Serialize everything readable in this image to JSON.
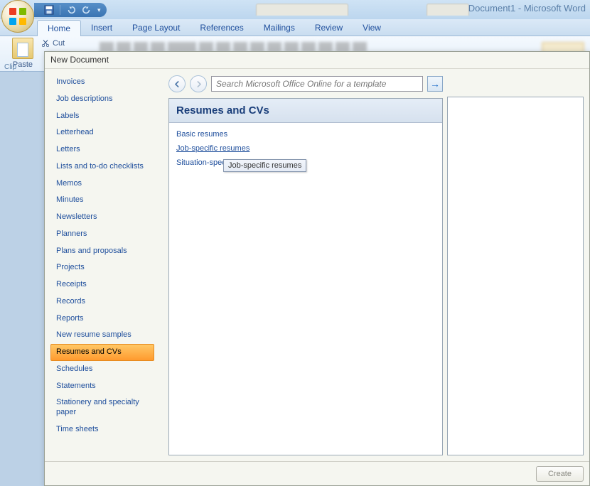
{
  "app": {
    "title": "Document1 - Microsoft Word"
  },
  "ribbon": {
    "tabs": [
      "Home",
      "Insert",
      "Page Layout",
      "References",
      "Mailings",
      "Review",
      "View"
    ],
    "active": 0,
    "paste_label": "Paste",
    "cut_label": "Cut",
    "clipboard_label": "Clip"
  },
  "dialog": {
    "title": "New Document",
    "search_placeholder": "Search Microsoft Office Online for a template",
    "categories": [
      "Invoices",
      "Job descriptions",
      "Labels",
      "Letterhead",
      "Letters",
      "Lists and to-do checklists",
      "Memos",
      "Minutes",
      "Newsletters",
      "Planners",
      "Plans and proposals",
      "Projects",
      "Receipts",
      "Records",
      "Reports",
      "New resume samples",
      "Resumes and CVs",
      "Schedules",
      "Statements",
      "Stationery and specialty paper",
      "Time sheets"
    ],
    "selected_category_index": 16,
    "result_heading": "Resumes and CVs",
    "result_links": [
      "Basic resumes",
      "Job-specific resumes",
      "Situation-specific resumes"
    ],
    "hovered_link_index": 1,
    "tooltip": "Job-specific resumes",
    "create_button": "Create"
  }
}
